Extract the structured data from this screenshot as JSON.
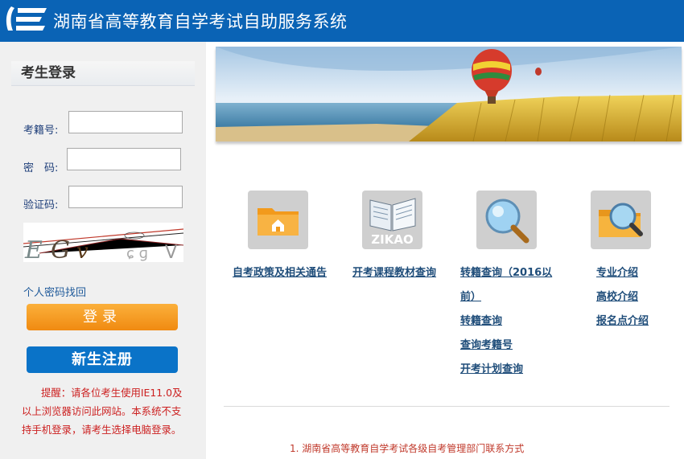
{
  "header": {
    "title": "湖南省高等教育自学考试自助服务系统"
  },
  "login": {
    "heading": "考生登录",
    "exam_no_label": "考籍号:",
    "password_label": "密　码:",
    "captcha_label": "验证码:",
    "exam_no_value": "",
    "password_value": "",
    "captcha_value": "",
    "captcha_text": "EGV V",
    "forgot_password": "个人密码找回",
    "login_button": "登录",
    "register_button": "新生注册",
    "notice": "提醒：请各位考生使用IE11.0及以上浏览器访问此网站。本系统不支持手机登录，请考生选择电脑登录。"
  },
  "icons": {
    "folder": "folder-icon",
    "book_label": "ZIKAO",
    "search": "magnifier-icon",
    "folder_search": "folder-search-icon"
  },
  "links": {
    "policy": "自考政策及相关通告",
    "textbook": "开考课程教材查询",
    "transfer_pre2016_line1": "转籍查询（2016以",
    "transfer_pre2016_line2": "前）",
    "transfer": "转籍查询",
    "exam_no_query": "查询考籍号",
    "plan": "开考计划查询",
    "major": "专业介绍",
    "school": "高校介绍",
    "signup": "报名点介绍"
  },
  "footer": {
    "contact": "1. 湖南省高等教育自学考试各级自考管理部门联系方式"
  },
  "colors": {
    "header": "#0a63b5",
    "login_button": "#f7a028",
    "register_button": "#0a73c8",
    "notice": "#cc1f1f"
  }
}
